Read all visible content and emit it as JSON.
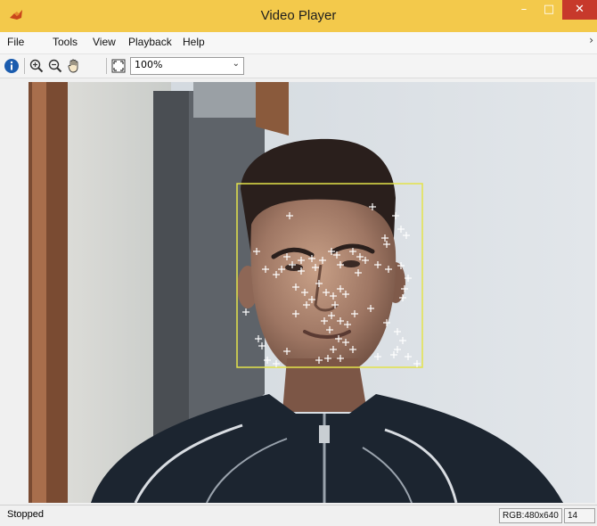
{
  "window": {
    "title": "Video Player",
    "accent_color": "#f3c94b",
    "close_color": "#c7392b"
  },
  "menu": {
    "items": [
      "File",
      "Tools",
      "View",
      "Playback",
      "Help"
    ]
  },
  "toolbar": {
    "zoom_value": "100%",
    "icons": [
      "info-icon",
      "zoom-in-icon",
      "zoom-out-icon",
      "pan-hand-icon",
      "fit-to-window-icon"
    ]
  },
  "video": {
    "bbox_color": "#e3e34a",
    "marker_color": "#ffffff"
  },
  "status": {
    "text": "Stopped",
    "color_info": "RGB:480x640",
    "frame": "14"
  }
}
